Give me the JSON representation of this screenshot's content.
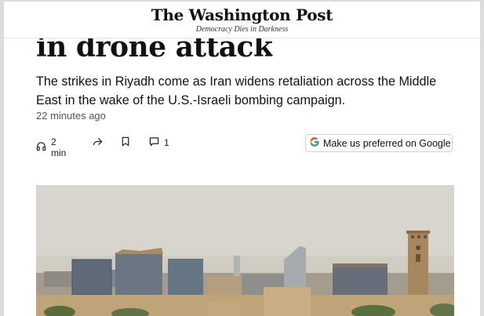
{
  "masthead": {
    "logo_text": "The Washington Post",
    "tagline": "Democracy Dies in Darkness"
  },
  "article": {
    "headline_fragment": "in drone attack",
    "dek": "The strikes in Riyadh come as Iran widens retaliation across the Middle East in the wake of the U.S.-Israeli bombing campaign.",
    "timestamp": "22 minutes ago"
  },
  "actions": {
    "listen_label": "2 min",
    "comments_count": "1",
    "preferred_button_label": "Make us preferred on Google"
  },
  "icons": [
    "headphones-icon",
    "share-icon",
    "bookmark-icon",
    "comment-icon",
    "google-g-icon"
  ],
  "colors": {
    "google_blue": "#4285F4",
    "google_red": "#EA4335",
    "google_yellow": "#FBBC05",
    "google_green": "#34A853",
    "sky": "#d9d6cf"
  }
}
